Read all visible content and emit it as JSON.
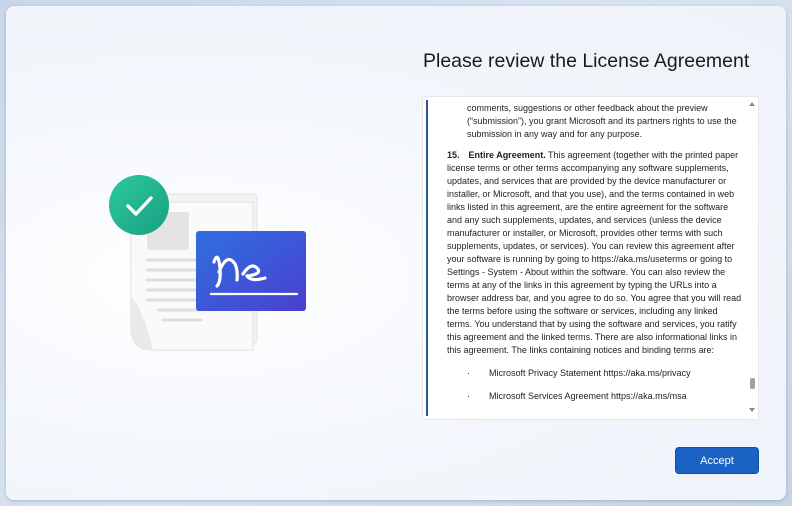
{
  "page": {
    "title": "Please review the License Agreement"
  },
  "license": {
    "continuation": "comments, suggestions or other feedback about the preview (“submission”), you grant Microsoft and its partners rights to use the submission in any way and for any purpose.",
    "section_number": "15.",
    "section_title": "Entire Agreement.",
    "section_body": "This agreement (together with the printed paper license terms or other terms accompanying any software supplements, updates, and services that are provided by the device manufacturer or installer, or Microsoft, and that you use), and the terms contained in web links listed in this agreement, are the entire agreement for the software and any such supplements, updates, and services (unless the device manufacturer or installer, or Microsoft, provides other terms with such supplements, updates, or services). You can review this agreement after your software is running by going to https://aka.ms/useterms or going to Settings - System - About within the software. You can also review the terms at any of the links in this agreement by typing the URLs into a browser address bar, and you agree to do so. You agree that you will read the terms before using the software or services, including any linked terms. You understand that by using the software and services, you ratify this agreement and the linked terms. There are also informational links in this agreement. The links containing notices and binding terms are:",
    "bullet_char": "·",
    "links": [
      "Microsoft Privacy Statement https://aka.ms/privacy",
      "Microsoft Services Agreement https://aka.ms/msa"
    ]
  },
  "scrollbar": {
    "position_fraction": 0.95
  },
  "actions": {
    "accept_label": "Accept"
  },
  "colors": {
    "accent": "#1a63c4",
    "check_badge": "#1fb08c",
    "signature_card": "#3d55d6"
  },
  "icons": {
    "illustration": "document-signature-illustration",
    "check": "checkmark-icon"
  }
}
